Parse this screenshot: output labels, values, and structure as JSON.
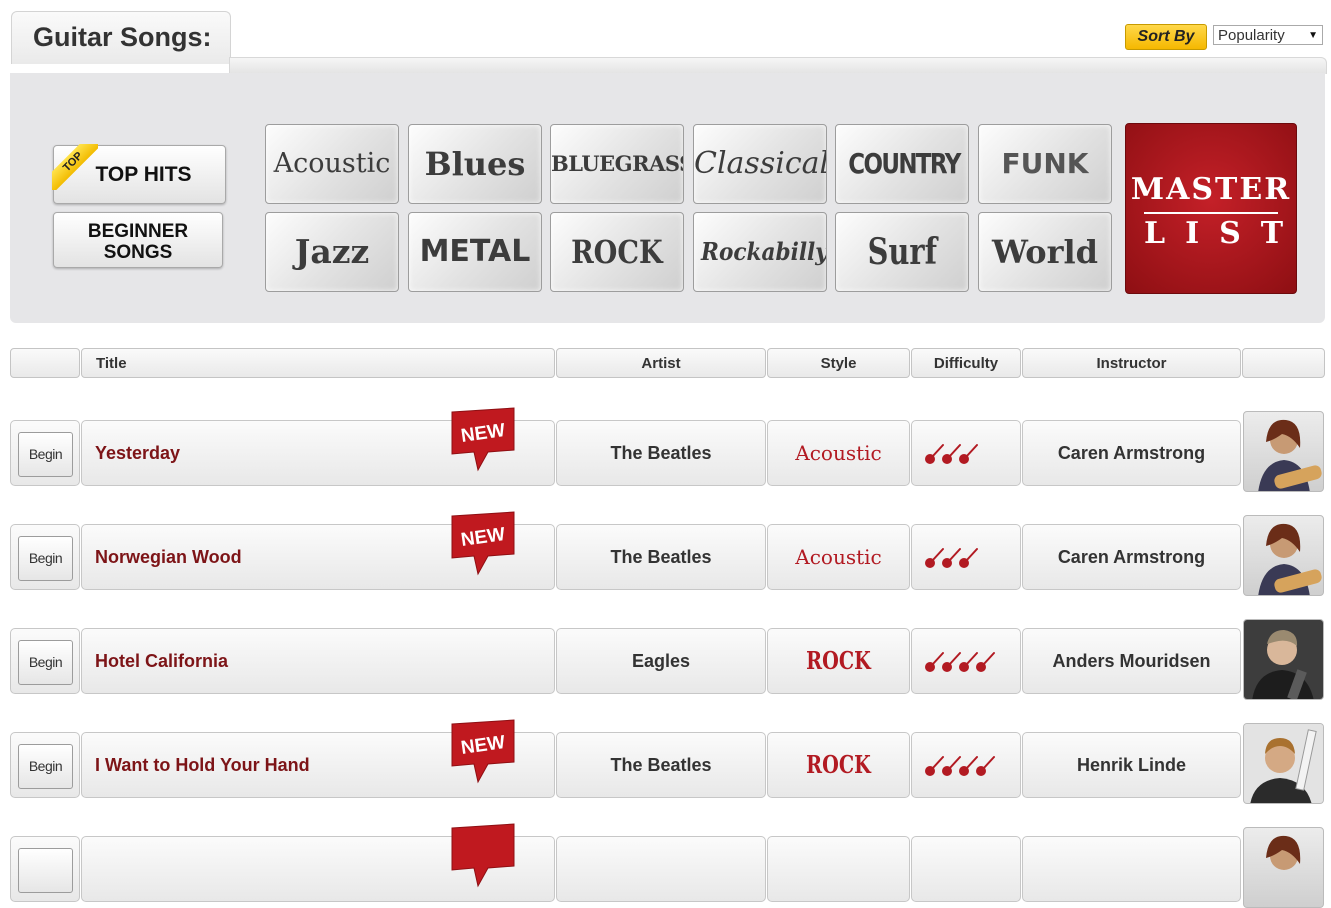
{
  "header": {
    "title": "Guitar Songs:"
  },
  "sort": {
    "label": "Sort By",
    "selected": "Popularity"
  },
  "side_buttons": {
    "top_hits": "TOP HITS",
    "top_badge": "TOP",
    "beginner_line1": "BEGINNER",
    "beginner_line2": "SONGS"
  },
  "styles": [
    "Acoustic",
    "Blues",
    "BLUEGRASS",
    "Classical",
    "COUNTRY",
    "FUNK",
    "Jazz",
    "METAL",
    "ROCK",
    "Rockabilly",
    "Surf",
    "World"
  ],
  "master": {
    "line1": "MASTER",
    "line2": "LIST"
  },
  "table": {
    "headers": [
      "Title",
      "Artist",
      "Style",
      "Difficulty",
      "Instructor"
    ]
  },
  "rows": [
    {
      "begin": "Begin",
      "title": "Yesterday",
      "new": "NEW",
      "artist": "The Beatles",
      "style": "Acoustic",
      "difficulty": 3,
      "instructor": "Caren Armstrong"
    },
    {
      "begin": "Begin",
      "title": "Norwegian Wood",
      "new": "NEW",
      "artist": "The Beatles",
      "style": "Acoustic",
      "difficulty": 3,
      "instructor": "Caren Armstrong"
    },
    {
      "begin": "Begin",
      "title": "Hotel California",
      "new": "",
      "artist": "Eagles",
      "style": "ROCK",
      "difficulty": 4,
      "instructor": "Anders Mouridsen"
    },
    {
      "begin": "Begin",
      "title": "I Want to Hold Your Hand",
      "new": "NEW",
      "artist": "The Beatles",
      "style": "ROCK",
      "difficulty": 4,
      "instructor": "Henrik Linde"
    }
  ],
  "colors": {
    "accent": "#7d1417",
    "style_red": "#b21a22",
    "sort_yellow": "#f5b800",
    "master_red": "#a3161b",
    "panel_bg": "#e6e6e8"
  }
}
